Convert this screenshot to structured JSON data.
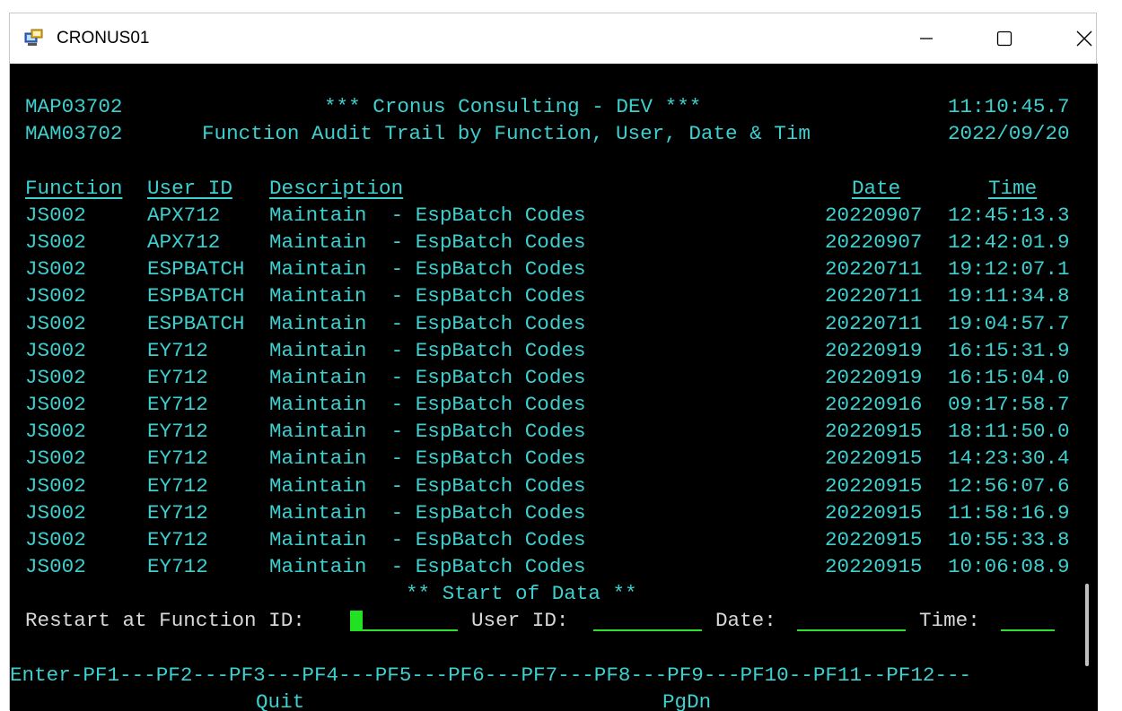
{
  "window": {
    "title": "CRONUS01"
  },
  "header": {
    "line1": {
      "program": "MAP03702",
      "title": "*** Cronus Consulting - DEV ***",
      "time": "11:10:45.7"
    },
    "line2": {
      "program": "MAM03702",
      "title": "Function Audit Trail by Function, User, Date & Tim",
      "date": "2022/09/20"
    }
  },
  "columns": {
    "function": "Function",
    "user": "User ID",
    "description": "Description",
    "date": "Date",
    "time": "Time"
  },
  "rows": [
    {
      "function": "JS002",
      "user": "APX712",
      "description": "Maintain  - EspBatch Codes",
      "date": "20220907",
      "time": "12:45:13.3"
    },
    {
      "function": "JS002",
      "user": "APX712",
      "description": "Maintain  - EspBatch Codes",
      "date": "20220907",
      "time": "12:42:01.9"
    },
    {
      "function": "JS002",
      "user": "ESPBATCH",
      "description": "Maintain  - EspBatch Codes",
      "date": "20220711",
      "time": "19:12:07.1"
    },
    {
      "function": "JS002",
      "user": "ESPBATCH",
      "description": "Maintain  - EspBatch Codes",
      "date": "20220711",
      "time": "19:11:34.8"
    },
    {
      "function": "JS002",
      "user": "ESPBATCH",
      "description": "Maintain  - EspBatch Codes",
      "date": "20220711",
      "time": "19:04:57.7"
    },
    {
      "function": "JS002",
      "user": "EY712",
      "description": "Maintain  - EspBatch Codes",
      "date": "20220919",
      "time": "16:15:31.9"
    },
    {
      "function": "JS002",
      "user": "EY712",
      "description": "Maintain  - EspBatch Codes",
      "date": "20220919",
      "time": "16:15:04.0"
    },
    {
      "function": "JS002",
      "user": "EY712",
      "description": "Maintain  - EspBatch Codes",
      "date": "20220916",
      "time": "09:17:58.7"
    },
    {
      "function": "JS002",
      "user": "EY712",
      "description": "Maintain  - EspBatch Codes",
      "date": "20220915",
      "time": "18:11:50.0"
    },
    {
      "function": "JS002",
      "user": "EY712",
      "description": "Maintain  - EspBatch Codes",
      "date": "20220915",
      "time": "14:23:30.4"
    },
    {
      "function": "JS002",
      "user": "EY712",
      "description": "Maintain  - EspBatch Codes",
      "date": "20220915",
      "time": "12:56:07.6"
    },
    {
      "function": "JS002",
      "user": "EY712",
      "description": "Maintain  - EspBatch Codes",
      "date": "20220915",
      "time": "11:58:16.9"
    },
    {
      "function": "JS002",
      "user": "EY712",
      "description": "Maintain  - EspBatch Codes",
      "date": "20220915",
      "time": "10:55:33.8"
    },
    {
      "function": "JS002",
      "user": "EY712",
      "description": "Maintain  - EspBatch Codes",
      "date": "20220915",
      "time": "10:06:08.9"
    }
  ],
  "status_message": "** Start of Data **",
  "restart": {
    "function_label": "Restart at Function ID:",
    "function_value": "",
    "user_label": "User ID:",
    "user_value": "",
    "date_label": "Date:",
    "date_value": "",
    "time_label": "Time:",
    "time_value": ""
  },
  "pfkeys": {
    "line": "Enter-PF1---PF2---PF3---PF4---PF5---PF6---PF7---PF8---PF9---PF10--PF11--PF12---",
    "pf3_label": "Quit",
    "pf8_label": "PgDn"
  },
  "colors": {
    "background": "#000000",
    "text": "#3ecfcf",
    "input": "#2ee02e",
    "label": "#d8d8d8"
  },
  "icons": {
    "app": "terminal-session-icon",
    "minimize": "minimize-icon",
    "maximize": "maximize-icon",
    "close": "close-icon"
  }
}
